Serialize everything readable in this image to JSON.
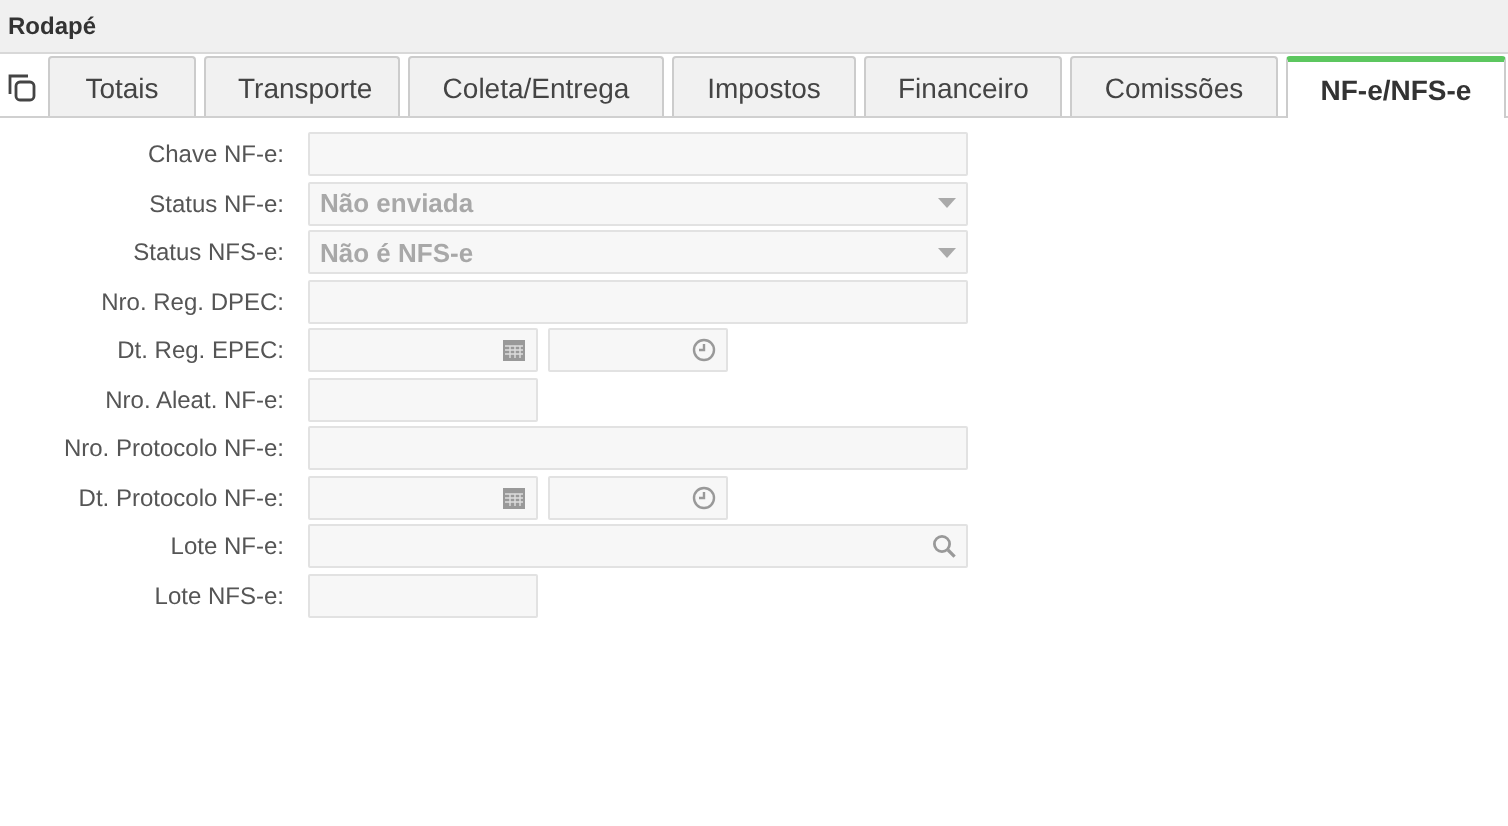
{
  "panel": {
    "title": "Rodapé"
  },
  "tabs": [
    {
      "label": "Totais",
      "selected": false
    },
    {
      "label": "Transporte",
      "selected": false
    },
    {
      "label": "Coleta/Entrega",
      "selected": false
    },
    {
      "label": "Impostos",
      "selected": false
    },
    {
      "label": "Financeiro",
      "selected": false
    },
    {
      "label": "Comissões",
      "selected": false
    },
    {
      "label": "NF-e/NFS-e",
      "selected": true
    }
  ],
  "fields": [
    {
      "label": "Chave NF-e:",
      "kind": "text"
    },
    {
      "label": "Status NF-e:",
      "kind": "select",
      "value": "Não enviada"
    },
    {
      "label": "Status NFS-e:",
      "kind": "select",
      "value": "Não é NFS-e"
    },
    {
      "label": "Nro. Reg. DPEC:",
      "kind": "text"
    },
    {
      "label": "Dt. Reg. EPEC:",
      "kind": "datetime"
    },
    {
      "label": "Nro. Aleat. NF-e:",
      "kind": "short"
    },
    {
      "label": "Nro. Protocolo NF-e:",
      "kind": "text"
    },
    {
      "label": "Dt. Protocolo NF-e:",
      "kind": "datetime"
    },
    {
      "label": "Lote NF-e:",
      "kind": "search"
    },
    {
      "label": "Lote NFS-e:",
      "kind": "short"
    }
  ]
}
